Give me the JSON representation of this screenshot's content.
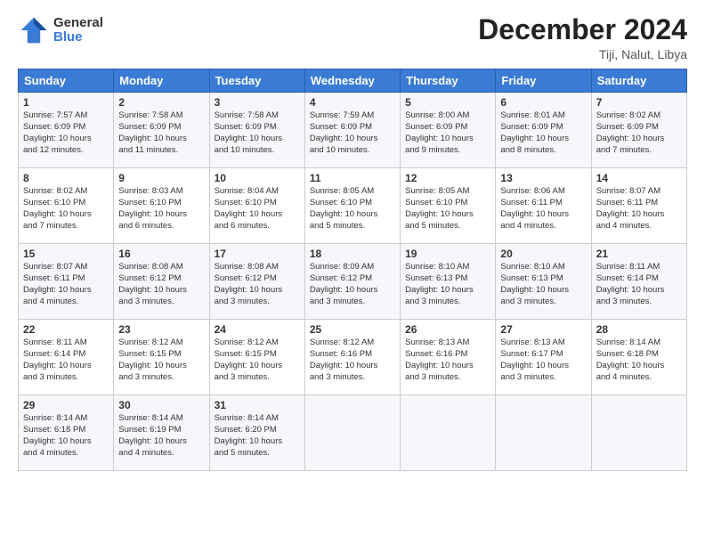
{
  "logo": {
    "general": "General",
    "blue": "Blue"
  },
  "title": "December 2024",
  "location": "Tiji, Nalut, Libya",
  "weekdays": [
    "Sunday",
    "Monday",
    "Tuesday",
    "Wednesday",
    "Thursday",
    "Friday",
    "Saturday"
  ],
  "weeks": [
    [
      {
        "day": "1",
        "content": "Sunrise: 7:57 AM\nSunset: 6:09 PM\nDaylight: 10 hours\nand 12 minutes."
      },
      {
        "day": "2",
        "content": "Sunrise: 7:58 AM\nSunset: 6:09 PM\nDaylight: 10 hours\nand 11 minutes."
      },
      {
        "day": "3",
        "content": "Sunrise: 7:58 AM\nSunset: 6:09 PM\nDaylight: 10 hours\nand 10 minutes."
      },
      {
        "day": "4",
        "content": "Sunrise: 7:59 AM\nSunset: 6:09 PM\nDaylight: 10 hours\nand 10 minutes."
      },
      {
        "day": "5",
        "content": "Sunrise: 8:00 AM\nSunset: 6:09 PM\nDaylight: 10 hours\nand 9 minutes."
      },
      {
        "day": "6",
        "content": "Sunrise: 8:01 AM\nSunset: 6:09 PM\nDaylight: 10 hours\nand 8 minutes."
      },
      {
        "day": "7",
        "content": "Sunrise: 8:02 AM\nSunset: 6:09 PM\nDaylight: 10 hours\nand 7 minutes."
      }
    ],
    [
      {
        "day": "8",
        "content": "Sunrise: 8:02 AM\nSunset: 6:10 PM\nDaylight: 10 hours\nand 7 minutes."
      },
      {
        "day": "9",
        "content": "Sunrise: 8:03 AM\nSunset: 6:10 PM\nDaylight: 10 hours\nand 6 minutes."
      },
      {
        "day": "10",
        "content": "Sunrise: 8:04 AM\nSunset: 6:10 PM\nDaylight: 10 hours\nand 6 minutes."
      },
      {
        "day": "11",
        "content": "Sunrise: 8:05 AM\nSunset: 6:10 PM\nDaylight: 10 hours\nand 5 minutes."
      },
      {
        "day": "12",
        "content": "Sunrise: 8:05 AM\nSunset: 6:10 PM\nDaylight: 10 hours\nand 5 minutes."
      },
      {
        "day": "13",
        "content": "Sunrise: 8:06 AM\nSunset: 6:11 PM\nDaylight: 10 hours\nand 4 minutes."
      },
      {
        "day": "14",
        "content": "Sunrise: 8:07 AM\nSunset: 6:11 PM\nDaylight: 10 hours\nand 4 minutes."
      }
    ],
    [
      {
        "day": "15",
        "content": "Sunrise: 8:07 AM\nSunset: 6:11 PM\nDaylight: 10 hours\nand 4 minutes."
      },
      {
        "day": "16",
        "content": "Sunrise: 8:08 AM\nSunset: 6:12 PM\nDaylight: 10 hours\nand 3 minutes."
      },
      {
        "day": "17",
        "content": "Sunrise: 8:08 AM\nSunset: 6:12 PM\nDaylight: 10 hours\nand 3 minutes."
      },
      {
        "day": "18",
        "content": "Sunrise: 8:09 AM\nSunset: 6:12 PM\nDaylight: 10 hours\nand 3 minutes."
      },
      {
        "day": "19",
        "content": "Sunrise: 8:10 AM\nSunset: 6:13 PM\nDaylight: 10 hours\nand 3 minutes."
      },
      {
        "day": "20",
        "content": "Sunrise: 8:10 AM\nSunset: 6:13 PM\nDaylight: 10 hours\nand 3 minutes."
      },
      {
        "day": "21",
        "content": "Sunrise: 8:11 AM\nSunset: 6:14 PM\nDaylight: 10 hours\nand 3 minutes."
      }
    ],
    [
      {
        "day": "22",
        "content": "Sunrise: 8:11 AM\nSunset: 6:14 PM\nDaylight: 10 hours\nand 3 minutes."
      },
      {
        "day": "23",
        "content": "Sunrise: 8:12 AM\nSunset: 6:15 PM\nDaylight: 10 hours\nand 3 minutes."
      },
      {
        "day": "24",
        "content": "Sunrise: 8:12 AM\nSunset: 6:15 PM\nDaylight: 10 hours\nand 3 minutes."
      },
      {
        "day": "25",
        "content": "Sunrise: 8:12 AM\nSunset: 6:16 PM\nDaylight: 10 hours\nand 3 minutes."
      },
      {
        "day": "26",
        "content": "Sunrise: 8:13 AM\nSunset: 6:16 PM\nDaylight: 10 hours\nand 3 minutes."
      },
      {
        "day": "27",
        "content": "Sunrise: 8:13 AM\nSunset: 6:17 PM\nDaylight: 10 hours\nand 3 minutes."
      },
      {
        "day": "28",
        "content": "Sunrise: 8:14 AM\nSunset: 6:18 PM\nDaylight: 10 hours\nand 4 minutes."
      }
    ],
    [
      {
        "day": "29",
        "content": "Sunrise: 8:14 AM\nSunset: 6:18 PM\nDaylight: 10 hours\nand 4 minutes."
      },
      {
        "day": "30",
        "content": "Sunrise: 8:14 AM\nSunset: 6:19 PM\nDaylight: 10 hours\nand 4 minutes."
      },
      {
        "day": "31",
        "content": "Sunrise: 8:14 AM\nSunset: 6:20 PM\nDaylight: 10 hours\nand 5 minutes."
      },
      {
        "day": "",
        "content": ""
      },
      {
        "day": "",
        "content": ""
      },
      {
        "day": "",
        "content": ""
      },
      {
        "day": "",
        "content": ""
      }
    ]
  ]
}
